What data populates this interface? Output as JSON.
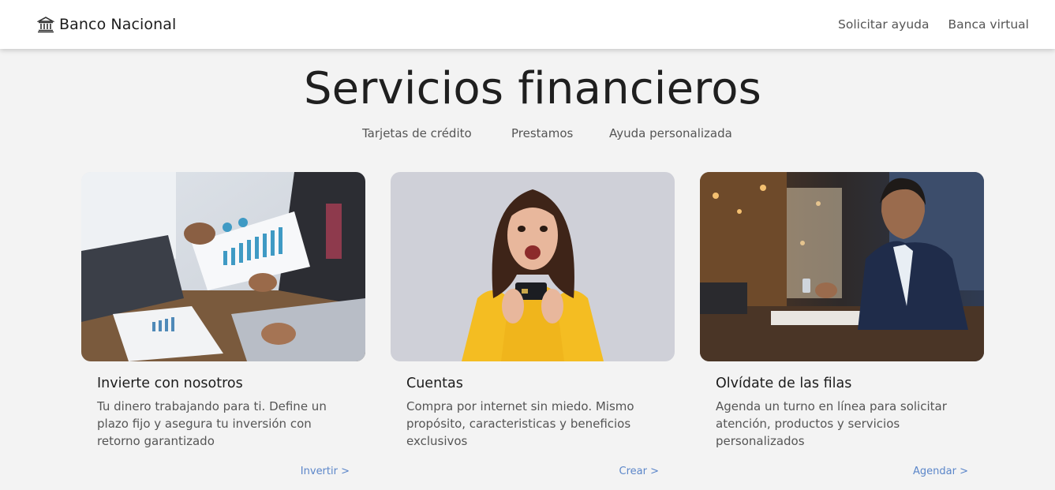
{
  "header": {
    "brand_name": "Banco Nacional",
    "links": [
      "Solicitar ayuda",
      "Banca virtual"
    ]
  },
  "hero": {
    "title": "Servicios financieros",
    "sub_links": [
      "Tarjetas de crédito",
      "Prestamos",
      "Ayuda personalizada"
    ]
  },
  "cards": [
    {
      "title": "Invierte con nosotros",
      "text": "Tu dinero trabajando para ti. Define un plazo fijo y asegura tu inversión con retorno garantizado",
      "link": "Invertir >"
    },
    {
      "title": "Cuentas",
      "text": "Compra por internet sin miedo. Mismo propósito, caracteristicas y beneficios exclusivos",
      "link": "Crear >"
    },
    {
      "title": "Olvídate de las filas",
      "text": "Agenda un turno en línea para solicitar atención, productos y servicios personalizados",
      "link": "Agendar >"
    }
  ],
  "icons": {
    "brand": "bank-icon"
  },
  "colors": {
    "link_accent": "#5b86c9",
    "background": "#f3f3f3"
  }
}
